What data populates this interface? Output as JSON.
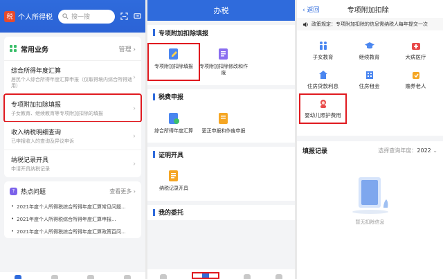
{
  "panel1": {
    "title": "个人所得税",
    "search_placeholder": "搜一搜",
    "common_services": {
      "title": "常用业务",
      "manage": "管理"
    },
    "items": [
      {
        "title": "综合所得年度汇算",
        "sub": "居民个人综合所得年度汇算申报（仅取得境内综合所得适用）"
      },
      {
        "title": "专项附加扣除填报",
        "sub": "子女教育、继续教育等专项附加扣除的填报"
      },
      {
        "title": "收入纳税明细查询",
        "sub": "已申报收入的查询及异议申诉"
      },
      {
        "title": "纳税记录开具",
        "sub": "申请开具纳税记录"
      }
    ],
    "hot": {
      "title": "热点问题",
      "more": "查看更多"
    },
    "news": [
      "2021年度个人所得税综合所得年度汇算常见问题...",
      "2021年度个人所得税综合所得年度汇算申报...",
      "2021年度个人所得税综合所得年度汇算政策百问..."
    ]
  },
  "panel2": {
    "title": "办税",
    "groups": [
      {
        "title": "专项附加扣除填报",
        "tiles": [
          "专项附加扣除填报",
          "专项附加扣除修改和作废"
        ]
      },
      {
        "title": "税费申报",
        "tiles": [
          "综合所得年度汇算",
          "更正申报和作废申报"
        ]
      },
      {
        "title": "证明开具",
        "tiles": [
          "纳税记录开具"
        ]
      },
      {
        "title": "我的委托",
        "tiles": []
      }
    ]
  },
  "panel3": {
    "back": "返回",
    "title": "专项附加扣除",
    "notice": "政策规定：专项附加扣除的信息需纳税人每年提交一次",
    "categories": [
      "子女教育",
      "继续教育",
      "大病医疗",
      "住房贷款利息",
      "住房租金",
      "赡养老人",
      "婴幼儿照护费用"
    ],
    "records": {
      "title": "填报记录",
      "year_label": "选择查询年度：",
      "year": "2022"
    },
    "empty_text": "暂无扣除信息"
  },
  "colors": {
    "brand_blue": "#2f6bdc",
    "highlight_red": "#e0191f"
  }
}
